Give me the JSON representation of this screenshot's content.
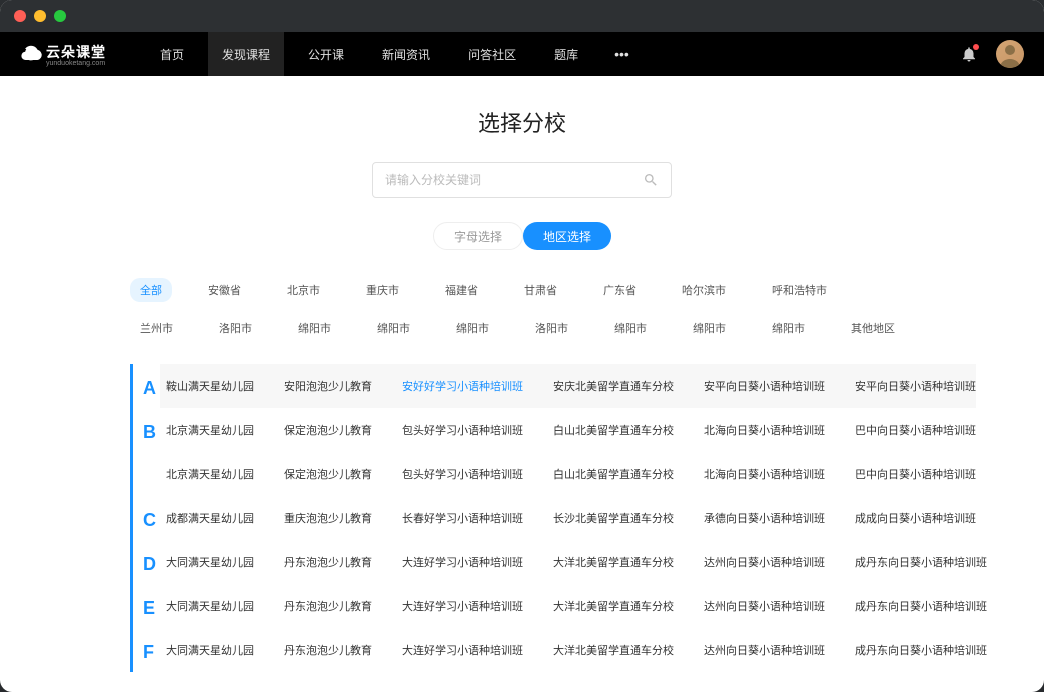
{
  "brand": {
    "name": "云朵课堂",
    "sub": "yunduoketang.com"
  },
  "nav": {
    "items": [
      "首页",
      "发现课程",
      "公开课",
      "新闻资讯",
      "问答社区",
      "题库"
    ],
    "active_index": 1
  },
  "page": {
    "title": "选择分校"
  },
  "search": {
    "placeholder": "请输入分校关键词"
  },
  "toggle": {
    "option_a": "字母选择",
    "option_b": "地区选择"
  },
  "regions": [
    "全部",
    "安徽省",
    "北京市",
    "重庆市",
    "福建省",
    "甘肃省",
    "广东省",
    "哈尔滨市",
    "呼和浩特市",
    "兰州市",
    "洛阳市",
    "绵阳市",
    "绵阳市",
    "绵阳市",
    "洛阳市",
    "绵阳市",
    "绵阳市",
    "绵阳市",
    "其他地区"
  ],
  "region_active": 0,
  "sections": [
    {
      "letter": "A",
      "first": true,
      "rows": [
        [
          "鞍山满天星幼儿园",
          "安阳泡泡少儿教育",
          {
            "t": "安好好学习小语种培训班",
            "hl": true
          },
          "安庆北美留学直通车分校",
          "安平向日葵小语种培训班",
          "安平向日葵小语种培训班"
        ]
      ]
    },
    {
      "letter": "B",
      "rows": [
        [
          "北京满天星幼儿园",
          "保定泡泡少儿教育",
          "包头好学习小语种培训班",
          "白山北美留学直通车分校",
          "北海向日葵小语种培训班",
          "巴中向日葵小语种培训班"
        ],
        [
          "北京满天星幼儿园",
          "保定泡泡少儿教育",
          "包头好学习小语种培训班",
          "白山北美留学直通车分校",
          "北海向日葵小语种培训班",
          "巴中向日葵小语种培训班"
        ]
      ]
    },
    {
      "letter": "C",
      "rows": [
        [
          "成都满天星幼儿园",
          "重庆泡泡少儿教育",
          "长春好学习小语种培训班",
          "长沙北美留学直通车分校",
          "承德向日葵小语种培训班",
          "成成向日葵小语种培训班"
        ]
      ]
    },
    {
      "letter": "D",
      "rows": [
        [
          "大同满天星幼儿园",
          "丹东泡泡少儿教育",
          "大连好学习小语种培训班",
          "大洋北美留学直通车分校",
          "达州向日葵小语种培训班",
          "成丹东向日葵小语种培训班"
        ]
      ]
    },
    {
      "letter": "E",
      "rows": [
        [
          "大同满天星幼儿园",
          "丹东泡泡少儿教育",
          "大连好学习小语种培训班",
          "大洋北美留学直通车分校",
          "达州向日葵小语种培训班",
          "成丹东向日葵小语种培训班"
        ]
      ]
    },
    {
      "letter": "F",
      "rows": [
        [
          "大同满天星幼儿园",
          "丹东泡泡少儿教育",
          "大连好学习小语种培训班",
          "大洋北美留学直通车分校",
          "达州向日葵小语种培训班",
          "成丹东向日葵小语种培训班"
        ]
      ]
    }
  ]
}
